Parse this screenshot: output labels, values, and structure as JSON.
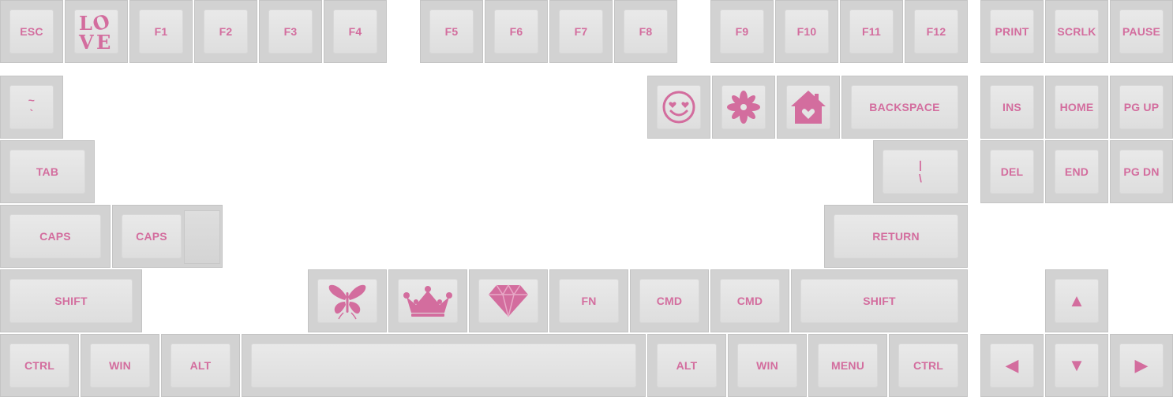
{
  "keyboard": {
    "accent_color": "#d36d9e",
    "keycap_color": "#e4e4e4",
    "function_row": {
      "esc": "ESC",
      "love_icon": "love-sculpture-icon",
      "f1": "F1",
      "f2": "F2",
      "f3": "F3",
      "f4": "F4",
      "f5": "F5",
      "f6": "F6",
      "f7": "F7",
      "f8": "F8",
      "f9": "F9",
      "f10": "F10",
      "f11": "F11",
      "f12": "F12",
      "print": "PRINT",
      "scrlk": "SCRLK",
      "pause": "PAUSE"
    },
    "number_row": {
      "tilde": "~\n`",
      "smiley_icon": "heart-eyes-smiley-icon",
      "flower_icon": "lotus-flower-icon",
      "home_icon": "home-heart-icon",
      "backspace": "BACKSPACE",
      "ins": "INS",
      "home": "HOME",
      "pgup": "PG UP"
    },
    "tab_row": {
      "tab": "TAB",
      "backslash": "|\n\\",
      "del": "DEL",
      "end": "END",
      "pgdn": "PG DN"
    },
    "caps_row": {
      "caps": "CAPS",
      "caps_iso": "CAPS",
      "return": "RETURN"
    },
    "shift_row": {
      "shift_left": "SHIFT",
      "butterfly_icon": "butterfly-icon",
      "crown_icon": "crown-icon",
      "diamond_icon": "diamond-icon",
      "fn": "FN",
      "cmd1": "CMD",
      "cmd2": "CMD",
      "shift_right": "SHIFT",
      "up": "▲"
    },
    "bottom_row": {
      "ctrl_left": "CTRL",
      "win_left": "WIN",
      "alt_left": "ALT",
      "alt_right": "ALT",
      "win_right": "WIN",
      "menu": "MENU",
      "ctrl_right": "CTRL",
      "left": "◀",
      "down": "▼",
      "right": "▶"
    }
  }
}
